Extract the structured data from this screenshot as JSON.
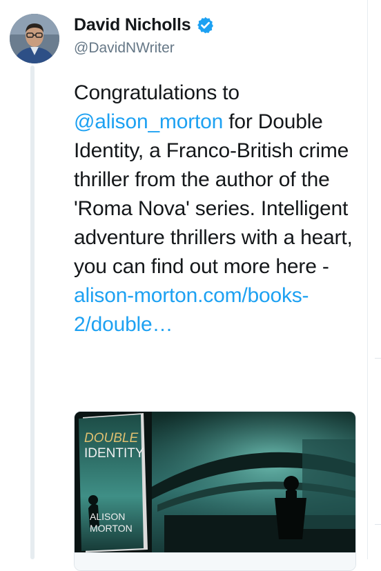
{
  "tweet": {
    "author": {
      "display_name": "David Nicholls",
      "handle": "@DavidNWriter",
      "verified": true,
      "avatar_icon": "avatar-photo"
    },
    "text": {
      "part1": "Congratulations to ",
      "mention": "@alison_morton",
      "part2": " for Double Identity, a Franco-British crime thriller from the author of the 'Roma Nova' series. Intelligent adventure thrillers with a heart, you can find out more here - ",
      "link": "alison-morton.com/books-2/double…"
    },
    "card": {
      "book_title_line1": "DOUBLE",
      "book_title_line2": "IDENTITY",
      "book_author_line1": "ALISON",
      "book_author_line2": "MORTON"
    }
  },
  "colors": {
    "link": "#1da1f2",
    "verified_badge": "#1da1f2",
    "secondary_text": "#657786"
  }
}
